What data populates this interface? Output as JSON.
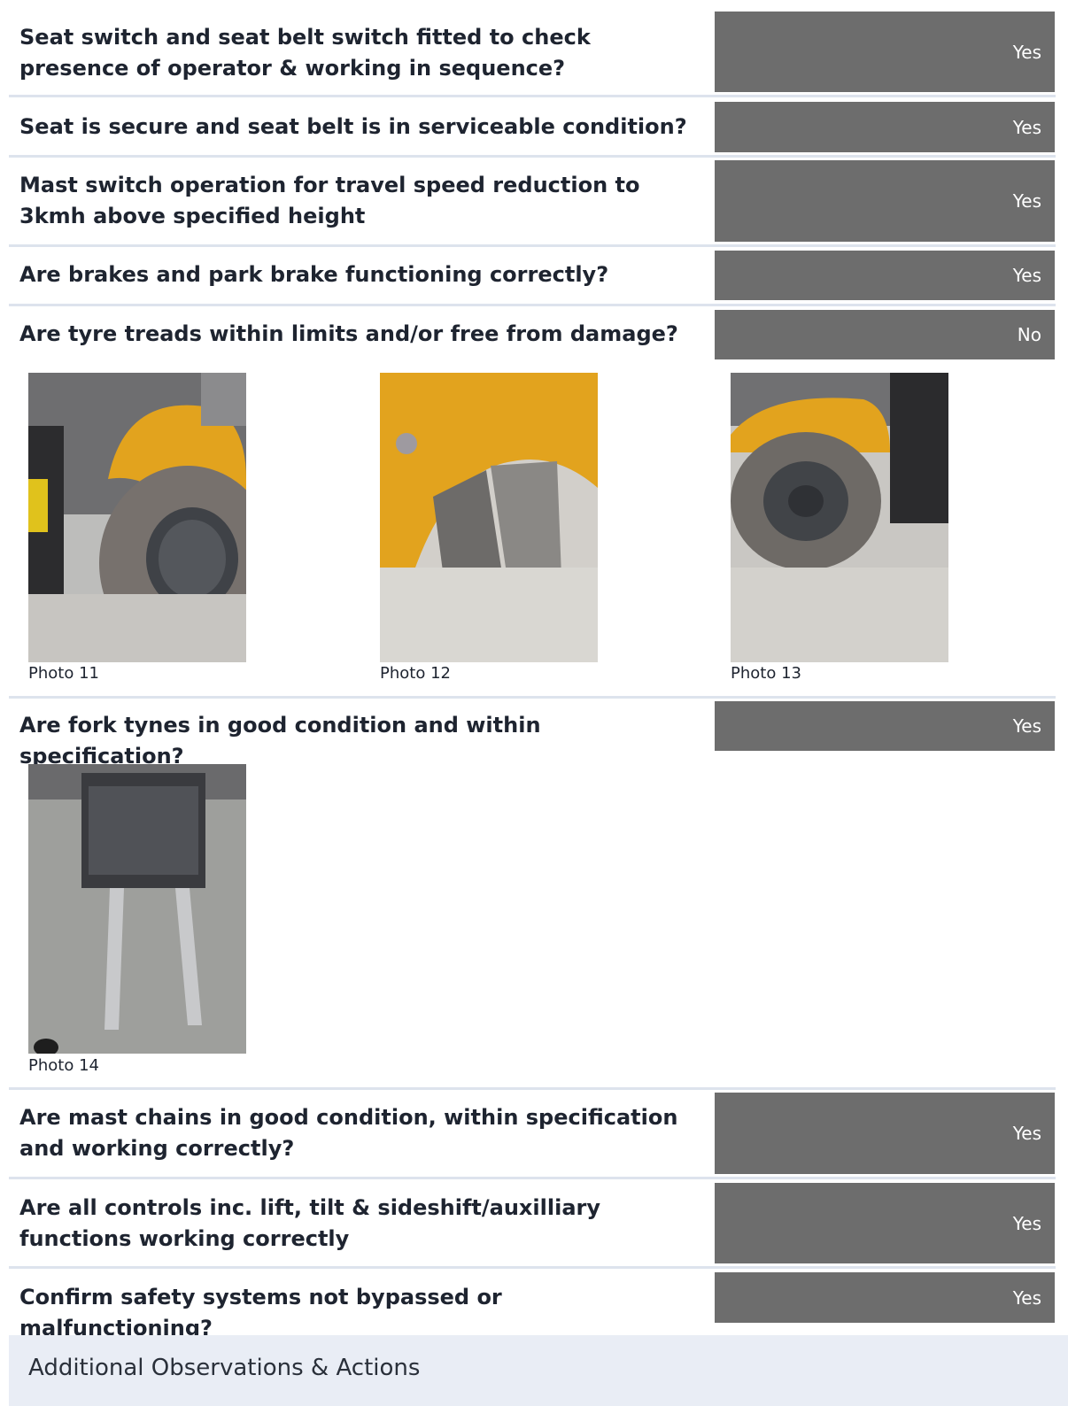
{
  "checklist": [
    {
      "question": "Seat switch and seat belt switch fitted to check presence of operator & working in sequence?",
      "answer": "Yes"
    },
    {
      "question": "Seat is secure and seat belt is in serviceable condition?",
      "answer": "Yes"
    },
    {
      "question": "Mast switch operation for travel speed reduction to 3kmh above specified height",
      "answer": "Yes"
    },
    {
      "question": "Are brakes and park brake functioning correctly?",
      "answer": "Yes"
    },
    {
      "question": "Are tyre treads within limits and/or free from damage?",
      "answer": "No"
    },
    {
      "question": "Are fork tynes in good condition and within specification?",
      "answer": "Yes"
    },
    {
      "question": "Are mast chains in good condition, within specification and working correctly?",
      "answer": "Yes"
    },
    {
      "question": "Are all controls inc. lift, tilt & sideshift/auxilliary functions working correctly",
      "answer": "Yes"
    },
    {
      "question": "Confirm safety systems not bypassed or malfunctioning?",
      "answer": "Yes"
    }
  ],
  "photos": {
    "p11": "Photo 11",
    "p12": "Photo 12",
    "p13": "Photo 13",
    "p14": "Photo 14"
  },
  "section": {
    "title": "Additional Observations & Actions"
  },
  "colors": {
    "answer_bg": "#6d6d6d",
    "divider": "#dde3ed",
    "section_bg": "#e9edf5",
    "tyre_yellow": "#e2a31e"
  }
}
